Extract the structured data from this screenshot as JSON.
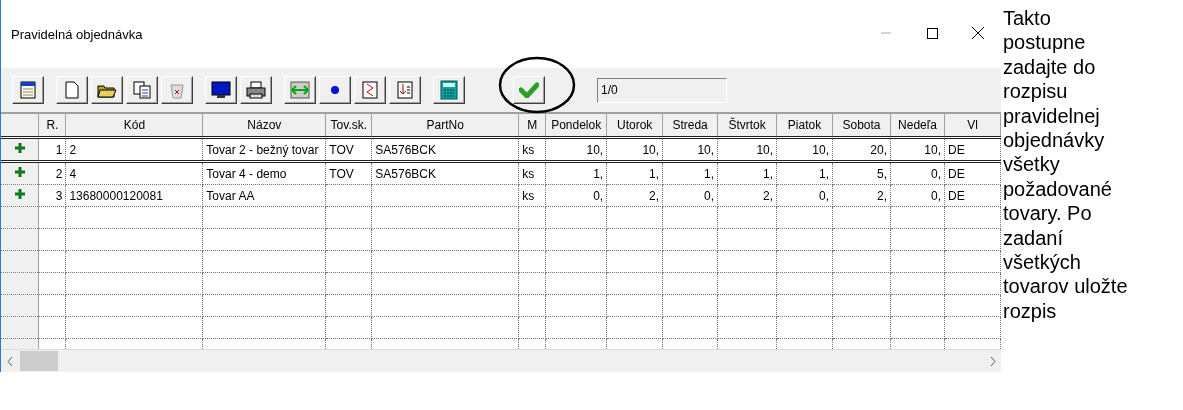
{
  "window": {
    "title": "Pravidelná objednávka"
  },
  "counter": {
    "value": "1/0"
  },
  "table": {
    "columns": [
      "R.",
      "Kód",
      "Názov",
      "Tov.sk.",
      "PartNo",
      "M",
      "Pondelok",
      "Utorok",
      "Streda",
      "Štvrtok",
      "Piatok",
      "Sobota",
      "Nedeľa",
      "Vl"
    ],
    "rows": [
      {
        "selected": true,
        "cells": [
          "1",
          "2",
          "Tovar 2 - bežný tovar",
          "TOV",
          "SA576BCK",
          "ks",
          "10,",
          "10,",
          "10,",
          "10,",
          "10,",
          "20,",
          "10,",
          "DE"
        ]
      },
      {
        "selected": false,
        "cells": [
          "2",
          "4",
          "Tovar 4 - demo",
          "TOV",
          "SA576BCK",
          "ks",
          "1,",
          "1,",
          "1,",
          "1,",
          "1,",
          "5,",
          "0,",
          "DE"
        ]
      },
      {
        "selected": false,
        "cells": [
          "3",
          "13680000120081",
          "Tovar AA",
          "",
          "",
          "ks",
          "0,",
          "2,",
          "0,",
          "2,",
          "0,",
          "2,",
          "0,",
          "DE"
        ]
      }
    ]
  },
  "instruction": "Takto postupne zadajte do rozpisu pravidelnej objednávky všetky požadované tovary. Po zadaní všetkých tovarov uložte rozpis"
}
